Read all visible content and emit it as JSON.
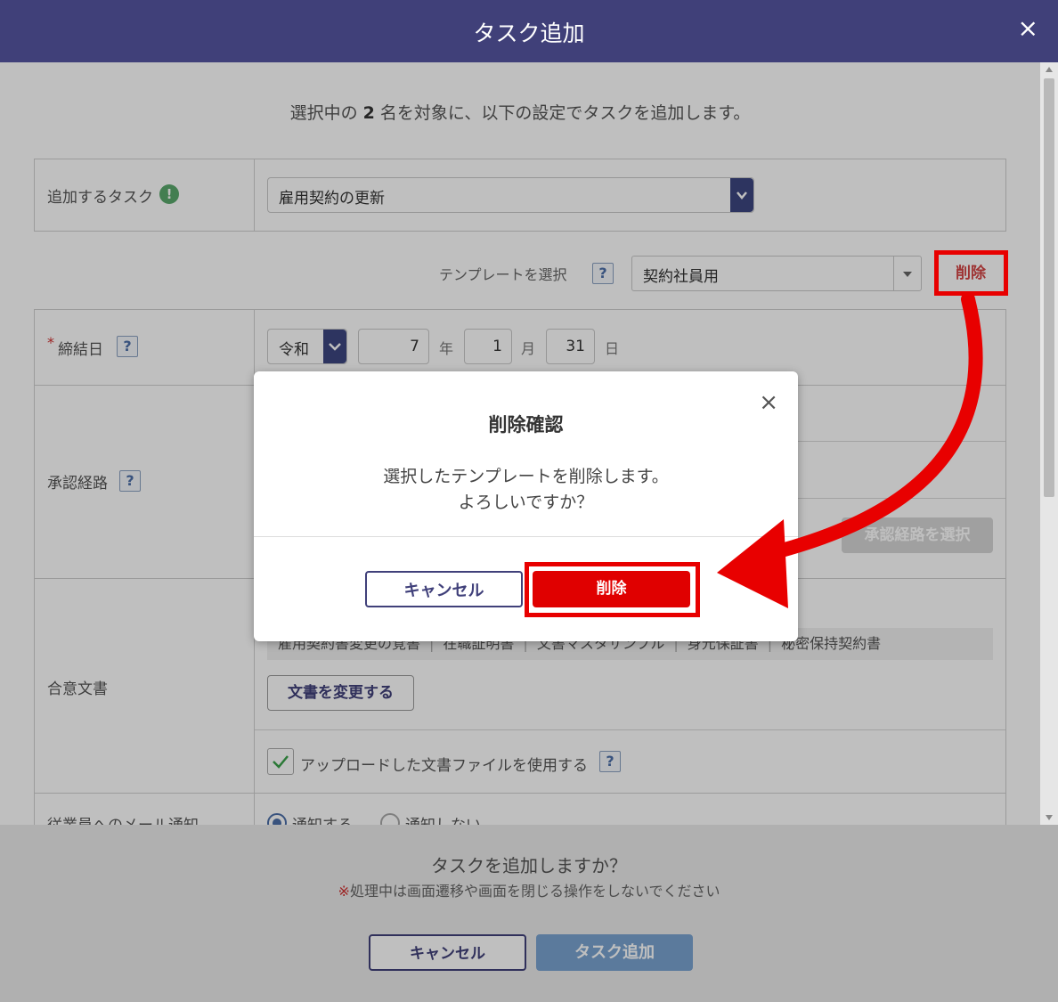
{
  "header": {
    "title": "タスク追加",
    "close": "×"
  },
  "intro": {
    "pre": "選択中の ",
    "count": "2",
    "post": " 名を対象に、以下の設定でタスクを追加します。"
  },
  "task": {
    "label": "追加するタスク",
    "value": "雇用契約の更新"
  },
  "template": {
    "label": "テンプレートを選択",
    "value": "契約社員用",
    "delete_label": "削除"
  },
  "contract_date": {
    "required": "*",
    "label": "締結日",
    "era": "令和",
    "year": "7",
    "year_unit": "年",
    "month": "1",
    "month_unit": "月",
    "day": "31",
    "day_unit": "日"
  },
  "approval": {
    "label": "承認経路",
    "select_button": "承認経路を選択"
  },
  "documents": {
    "label": "合意文書",
    "items": [
      "雇用契約書変更の覚書",
      "在職証明書",
      "文書マスタサンプル",
      "身元保証書",
      "秘密保持契約書"
    ],
    "change_button": "文書を変更する",
    "checkbox_label": "アップロードした文書ファイルを使用する"
  },
  "mail": {
    "label": "従業員へのメール通知",
    "option_yes": "通知する",
    "option_no": "通知しない"
  },
  "footer": {
    "question": "タスクを追加しますか？",
    "note_mark": "※",
    "note": "処理中は画面遷移や画面を閉じる操作をしないでください",
    "cancel": "キャンセル",
    "submit": "タスク追加"
  },
  "modal": {
    "title": "削除確認",
    "message_line1": "選択したテンプレートを削除します。",
    "message_line2": "よろしいですか？",
    "cancel": "キャンセル",
    "confirm": "削除",
    "close": "×"
  },
  "colors": {
    "header": "#404079",
    "danger": "#e80000",
    "accent": "#3d4680",
    "primary_disabled": "#7aa3d0"
  },
  "icons": {
    "task_info": "exclamation-icon",
    "help": "question-icon",
    "close": "close-icon",
    "arrow": "red-curved-arrow-annotation"
  }
}
